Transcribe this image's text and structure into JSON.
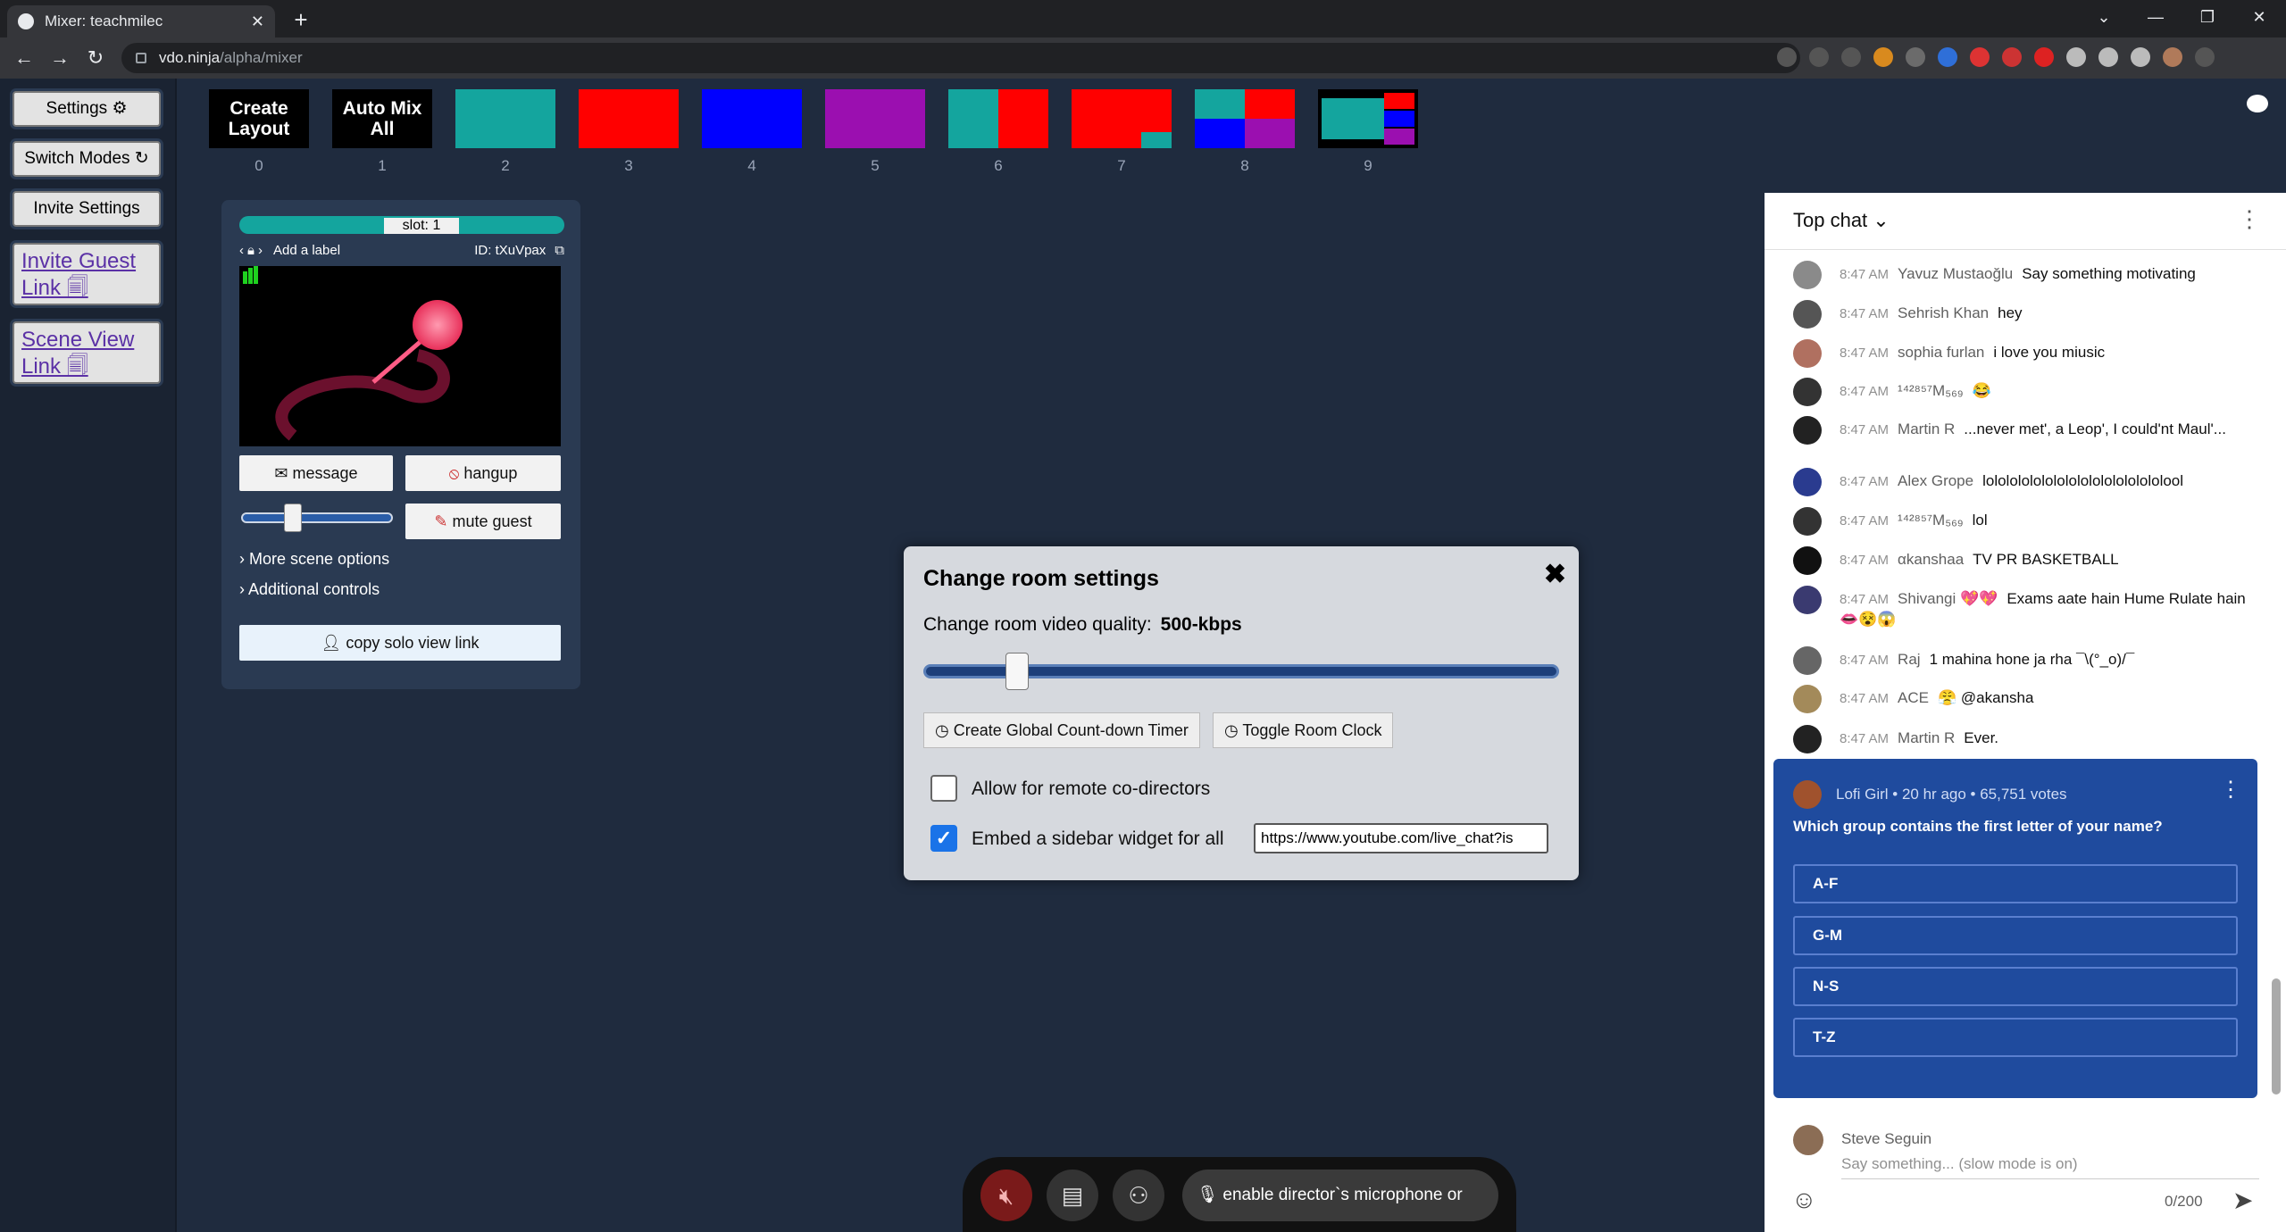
{
  "browser": {
    "tab_title": "Mixer: teachmilec",
    "url_host": "vdo.ninja",
    "url_path": "/alpha/mixer"
  },
  "sidebar": {
    "settings": "Settings ⚙",
    "switch_modes": "Switch Modes ↻",
    "invite_settings": "Invite Settings",
    "invite_guest_link": "Invite Guest Link 🗐",
    "scene_view_link": "Scene View Link 🗐"
  },
  "layouts": {
    "create": "Create Layout",
    "automix": "Auto Mix All",
    "numbers": [
      "0",
      "1",
      "2",
      "3",
      "4",
      "5",
      "6",
      "7",
      "8",
      "9"
    ]
  },
  "guest_card": {
    "slot": "slot: 1",
    "add_label": "Add a label",
    "id": "ID: tXuVpax",
    "message": "message",
    "hangup": "hangup",
    "mute_guest": "mute guest",
    "volume_level": 0.3,
    "more_scene_options": "More scene options",
    "additional_controls": "Additional controls",
    "copy_solo": "copy solo view link"
  },
  "modal": {
    "title": "Change room settings",
    "quality_label": "Change room video quality:",
    "quality_value": "500-kbps",
    "quality_slider_level": 0.14,
    "timer_button": "Create Global Count-down Timer",
    "clock_button": "Toggle Room Clock",
    "allow_codirectors": "Allow for remote co-directors",
    "allow_codirectors_checked": false,
    "embed_sidebar": "Embed a sidebar widget for all",
    "embed_sidebar_checked": true,
    "embed_url": "https://www.youtube.com/live_chat?is"
  },
  "control_bar": {
    "mic_label": "enable director`s microphone or video"
  },
  "chat": {
    "header": "Top chat",
    "messages": [
      {
        "time": "8:47 AM",
        "author": "Yavuz Mustaoğlu",
        "text": "Say something motivating"
      },
      {
        "time": "8:47 AM",
        "author": "Sehrish Khan",
        "text": "hey"
      },
      {
        "time": "8:47 AM",
        "author": "sophia furlan",
        "text": "i love you miusic"
      },
      {
        "time": "8:47 AM",
        "author": "¹⁴²⁸⁵⁷M₅₆₉",
        "text": "😂"
      },
      {
        "time": "8:47 AM",
        "author": "Martin R",
        "text": "...never met', a Leop', I could'nt Maul'..."
      },
      {
        "time": "8:47 AM",
        "author": "Alex Grope",
        "text": "lolololololololololololololololool"
      },
      {
        "time": "8:47 AM",
        "author": "¹⁴²⁸⁵⁷M₅₆₉",
        "text": "lol"
      },
      {
        "time": "8:47 AM",
        "author": "αkanshaa",
        "text": "TV PR BASKETBALL"
      },
      {
        "time": "8:47 AM",
        "author": "Shivangi 💖💖",
        "text": "Exams aate hain Hume Rulate hain 👄😵😱"
      },
      {
        "time": "8:47 AM",
        "author": "Raj",
        "text": "1 mahina hone ja rha ¯\\(°_o)/¯"
      },
      {
        "time": "8:47 AM",
        "author": "ACE",
        "text": "😤 @akansha"
      },
      {
        "time": "8:47 AM",
        "author": "Martin R",
        "text": "Ever."
      }
    ],
    "poll": {
      "header": "Lofi Girl • 20 hr ago • 65,751 votes",
      "question": "Which group contains the first letter of your name?",
      "options": [
        "A-F",
        "G-M",
        "N-S",
        "T-Z"
      ]
    },
    "composer": {
      "name": "Steve Seguin",
      "placeholder": "Say something... (slow mode is on)",
      "count": "0/200"
    }
  },
  "colors": {
    "teal": "#14a59e",
    "red": "#ff0000",
    "blue": "#0000ff",
    "purple": "#9b0fb0",
    "stage_bg": "#1f2b3e",
    "poll_bg": "#1f4b9e"
  }
}
